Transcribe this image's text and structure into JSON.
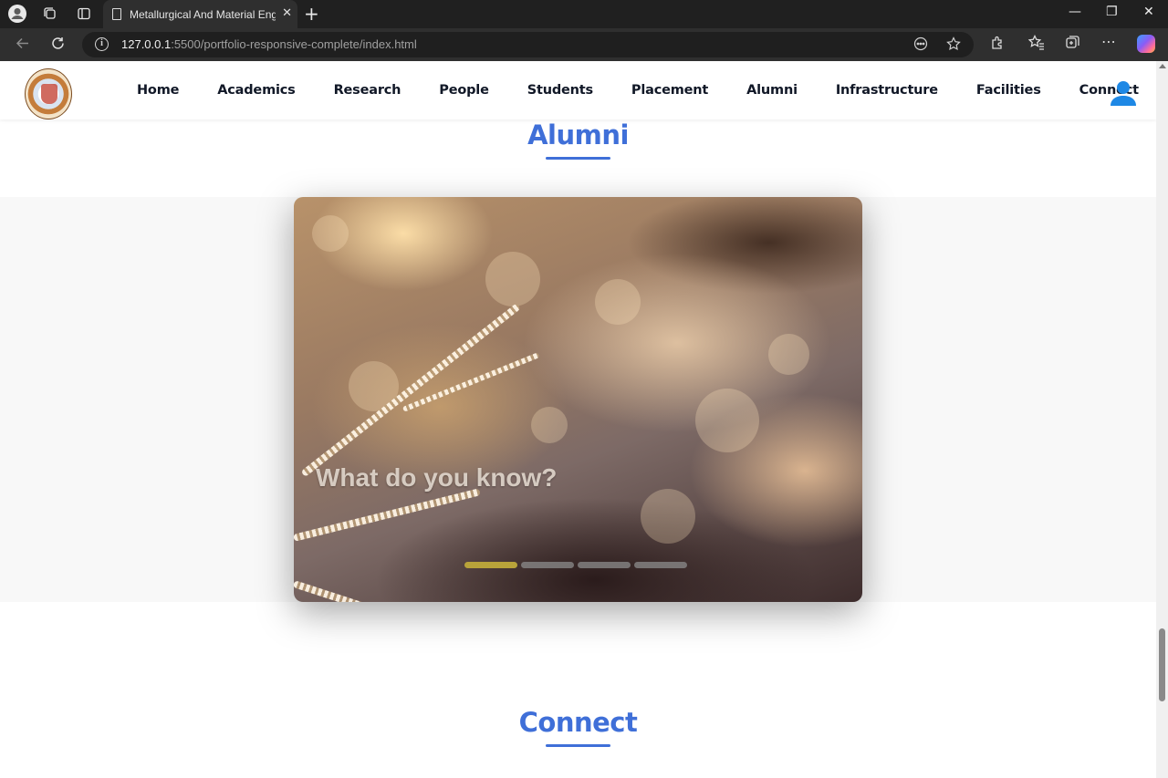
{
  "browser": {
    "tab_title": "Metallurgical And Material Engine",
    "tab_close": "✕",
    "new_tab": "+",
    "url_host": "127.0.0.1",
    "url_path": ":5500/portfolio-responsive-complete/index.html",
    "window_controls": {
      "minimize": "—",
      "maximize": "❐",
      "close": "✕"
    }
  },
  "site": {
    "nav": [
      {
        "label": "Home"
      },
      {
        "label": "Academics"
      },
      {
        "label": "Research"
      },
      {
        "label": "People"
      },
      {
        "label": "Students"
      },
      {
        "label": "Placement"
      },
      {
        "label": "Alumni"
      },
      {
        "label": "Infrastructure"
      },
      {
        "label": "Facilities"
      },
      {
        "label": "Connect"
      }
    ],
    "user_icon": "user-icon"
  },
  "alumni": {
    "title": "Alumni",
    "carousel": {
      "caption": "What do you know?",
      "slide_count": 4,
      "active_slide": 1
    }
  },
  "connect": {
    "title": "Connect"
  },
  "colors": {
    "accent": "#3f6fd8",
    "indicator_active": "#b8a33a",
    "user_icon": "#1e88e5"
  }
}
